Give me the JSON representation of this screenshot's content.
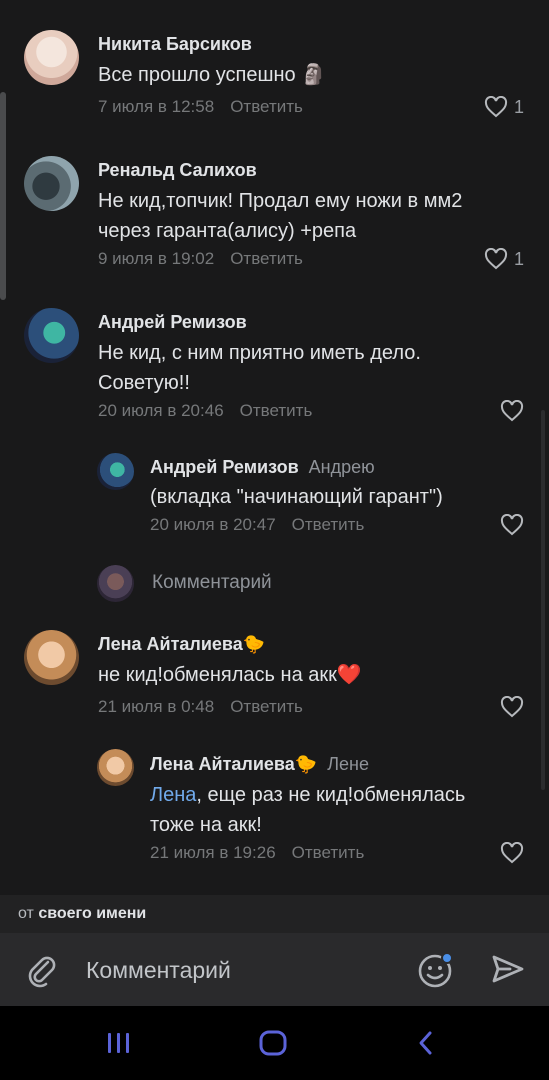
{
  "comments": [
    {
      "author": "Никита Барсиков",
      "text_lines": [
        "Все прошло успешно 🗿"
      ],
      "date": "7 июля в 12:58",
      "reply_label": "Ответить",
      "likes": "1"
    },
    {
      "author": "Ренальд Салихов",
      "text_lines": [
        "Не кид,топчик! Продал ему ножи в мм2",
        "через гаранта(алису) +репа"
      ],
      "date": "9 июля в 19:02",
      "reply_label": "Ответить",
      "likes": "1"
    },
    {
      "author": "Андрей Ремизов",
      "text_lines": [
        "Не кид, с ним приятно иметь дело.",
        "Советую!!"
      ],
      "date": "20 июля в 20:46",
      "reply_label": "Ответить",
      "likes": ""
    }
  ],
  "reply1": {
    "author": "Андрей Ремизов",
    "reply_to": "Андрею",
    "text": "(вкладка \"начинающий гарант\")",
    "date": "20 июля в 20:47",
    "reply_label": "Ответить"
  },
  "thread_input": {
    "placeholder": "Комментарий"
  },
  "comment4": {
    "author": "Лена Айталиева🐤",
    "text": "не кид!обменялась на акк❤️",
    "date": "21 июля в 0:48",
    "reply_label": "Ответить"
  },
  "reply2": {
    "author": "Лена Айталиева🐤",
    "reply_to": "Лене",
    "mention": "Лена",
    "text_rest": ", еще раз не кид!обменялась",
    "text_line2": "тоже на акк!",
    "date": "21 июля в 19:26",
    "reply_label": "Ответить"
  },
  "posting_as": {
    "prefix": "от ",
    "value": "своего имени"
  },
  "composer": {
    "placeholder": "Комментарий"
  },
  "colors": {
    "background": "#19191a",
    "link": "#71aaeb",
    "meta": "#76787a"
  },
  "icons": [
    "heart-icon",
    "paperclip-icon",
    "emoji-icon",
    "send-icon",
    "recent-apps-icon",
    "home-icon",
    "back-icon"
  ]
}
